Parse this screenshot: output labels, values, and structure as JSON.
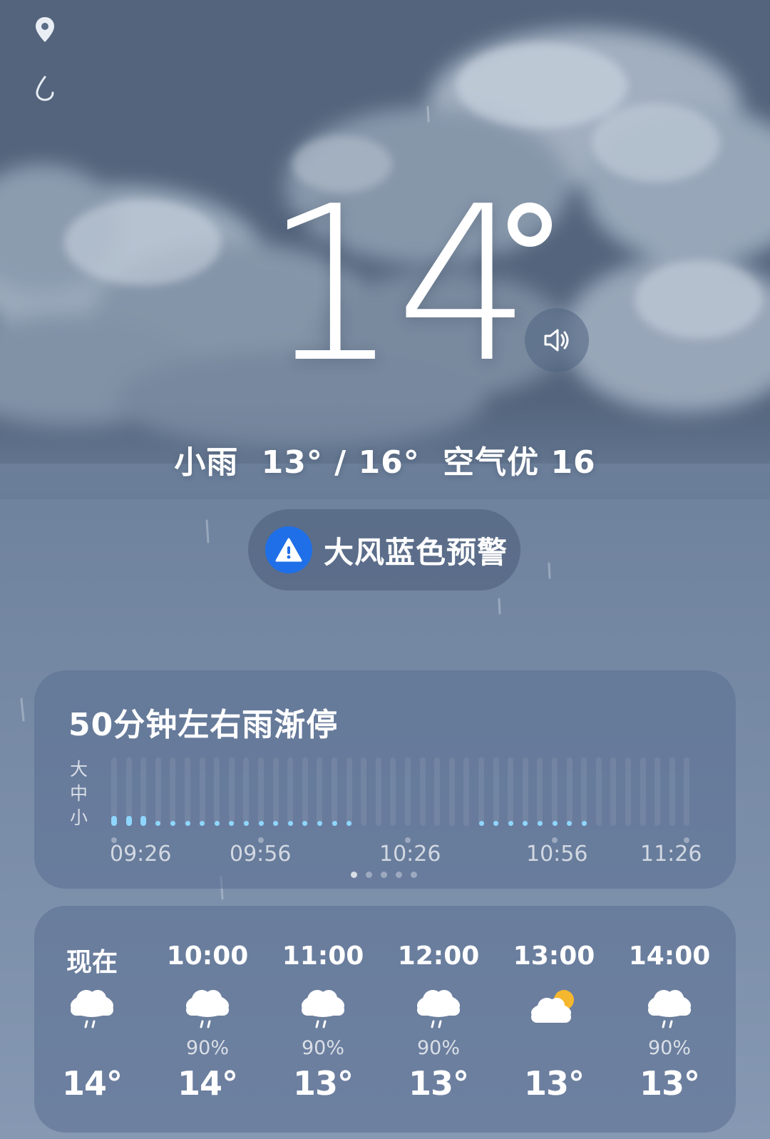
{
  "current": {
    "temperature": "14",
    "condition": "小雨",
    "temp_range": "13° / 16°",
    "air_quality": "空气优 16"
  },
  "alert": {
    "text": "大风蓝色预警",
    "color": "#1f6fe8"
  },
  "precipitation": {
    "title": "50分钟左右雨渐停",
    "levels": [
      "大",
      "中",
      "小"
    ],
    "times": [
      "09:26",
      "09:56",
      "10:26",
      "10:56",
      "11:26"
    ],
    "accent_color": "#8fd6ff"
  },
  "hourly": [
    {
      "time": "现在",
      "icon": "rain-cloud-icon",
      "pop": "",
      "temp": "14°"
    },
    {
      "time": "10:00",
      "icon": "rain-cloud-icon",
      "pop": "90%",
      "temp": "14°"
    },
    {
      "time": "11:00",
      "icon": "rain-cloud-icon",
      "pop": "90%",
      "temp": "13°"
    },
    {
      "time": "12:00",
      "icon": "rain-cloud-icon",
      "pop": "90%",
      "temp": "13°"
    },
    {
      "time": "13:00",
      "icon": "partly-cloudy-icon",
      "pop": "",
      "temp": "13°"
    },
    {
      "time": "14:00",
      "icon": "rain-cloud-icon",
      "pop": "90%",
      "temp": "13°"
    }
  ]
}
